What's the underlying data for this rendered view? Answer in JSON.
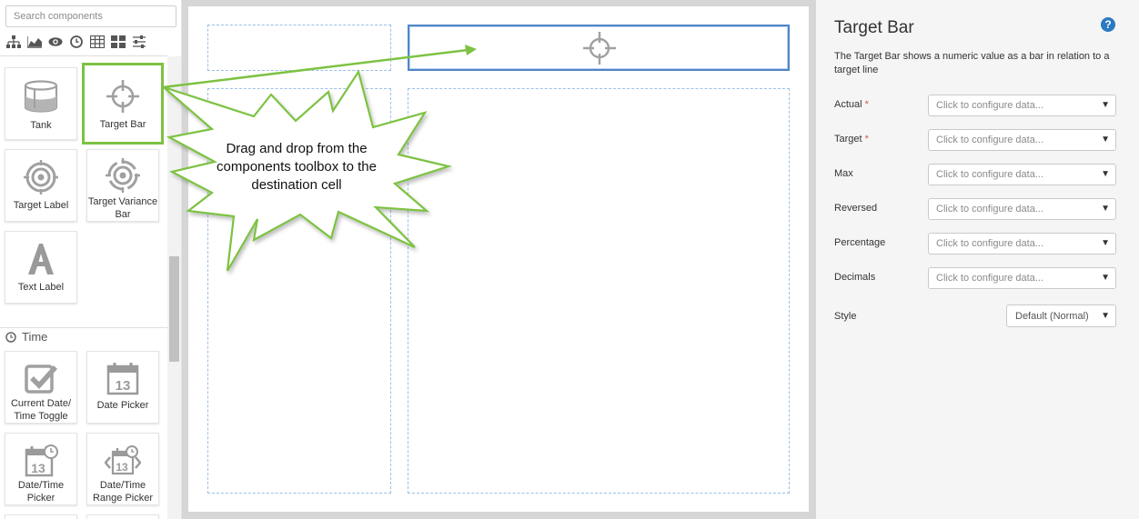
{
  "toolbox": {
    "search_placeholder": "Search components",
    "category_icons": [
      "hierarchy-icon",
      "area-chart-icon",
      "eye-icon",
      "clock-icon",
      "table-icon",
      "grid-icon",
      "sliders-icon"
    ],
    "tiles": [
      {
        "label": "Tank",
        "icon": "tank-icon"
      },
      {
        "label": "Target Bar",
        "icon": "target-crosshair-icon",
        "selected": true
      },
      {
        "label": "Target Label",
        "icon": "target-label-icon"
      },
      {
        "label": "Target Variance Bar",
        "icon": "target-variance-icon"
      },
      {
        "label": "Text Label",
        "icon": "text-label-icon"
      }
    ],
    "section": {
      "title": "Time",
      "icon": "clock-icon"
    },
    "time_tiles": [
      {
        "label": "Current Date/ Time Toggle",
        "icon": "checkbox-icon"
      },
      {
        "label": "Date Picker",
        "icon": "calendar-icon",
        "day": "13"
      },
      {
        "label": "Date/Time Picker",
        "icon": "calendar-clock-icon",
        "day": "13"
      },
      {
        "label": "Date/Time Range Picker",
        "icon": "calendar-range-icon",
        "day": "13"
      }
    ]
  },
  "callout": {
    "text": "Drag and drop from the components toolbox to the destination cell",
    "accent": "#7dc242"
  },
  "panel": {
    "title": "Target Bar",
    "help": "?",
    "description": "The Target Bar shows a numeric value as a bar in relation to a target line",
    "placeholder": "Click to configure data...",
    "properties": [
      {
        "label": "Actual",
        "required": true
      },
      {
        "label": "Target",
        "required": true
      },
      {
        "label": "Max",
        "required": false
      },
      {
        "label": "Reversed",
        "required": false
      },
      {
        "label": "Percentage",
        "required": false
      },
      {
        "label": "Decimals",
        "required": false
      }
    ],
    "style": {
      "label": "Style",
      "value": "Default (Normal)"
    }
  },
  "colors": {
    "accent_green": "#7dc242",
    "cell_border": "#9cc0e6",
    "active_cell": "#4f86c6",
    "help_blue": "#2b79c2",
    "required_red": "#d9534f"
  }
}
